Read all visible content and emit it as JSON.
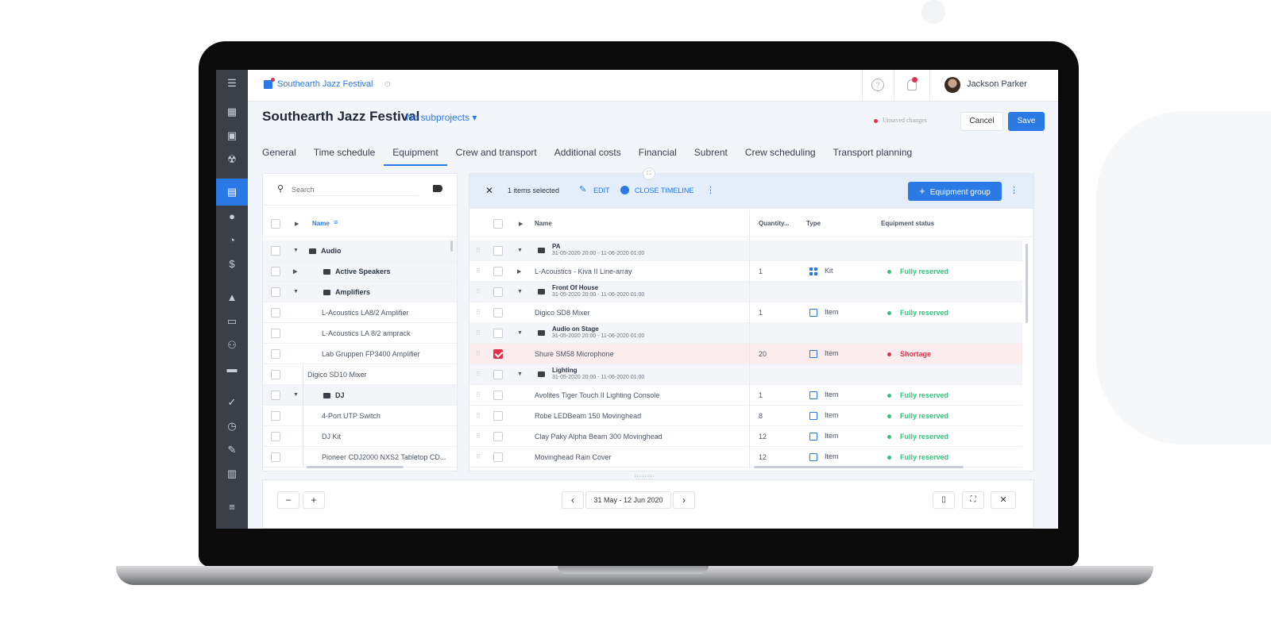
{
  "app": {
    "project_link": "Southearth Jazz Festival",
    "project_title": "Southearth Jazz Festival",
    "subprojects": "No subprojects ▾",
    "user_name": "Jackson Parker",
    "unsaved": "Unsaved changes",
    "cancel": "Cancel",
    "save": "Save"
  },
  "tabs": [
    "General",
    "Time schedule",
    "Equipment",
    "Crew and transport",
    "Additional costs",
    "Financial",
    "Subrent",
    "Crew scheduling",
    "Transport planning"
  ],
  "left_panel": {
    "search_placeholder": "Search",
    "name_header": "Name",
    "rows": [
      {
        "label": "Audio",
        "group": true,
        "indent": 0
      },
      {
        "label": "Active Speakers",
        "group": true,
        "indent": 1
      },
      {
        "label": "Amplifiers",
        "group": true,
        "indent": 1
      },
      {
        "label": "L-Acoustics LA8/2 Amplifier",
        "group": false,
        "indent": 2
      },
      {
        "label": "L-Acoustics LA 8/2 amprack",
        "group": false,
        "indent": 2
      },
      {
        "label": "Lab Gruppen FP3400 Amplifier",
        "group": false,
        "indent": 2
      },
      {
        "label": "Digico SD10 Mixer",
        "group": false,
        "indent": 1
      },
      {
        "label": "DJ",
        "group": true,
        "indent": 1
      },
      {
        "label": "4-Port UTP Switch",
        "group": false,
        "indent": 2
      },
      {
        "label": "DJ Kit",
        "group": false,
        "indent": 2
      },
      {
        "label": "Pioneer CDJ2000 NXS2 Tabletop CD...",
        "group": false,
        "indent": 2
      }
    ]
  },
  "right_panel": {
    "selected": "1 items selected",
    "edit": "EDIT",
    "close_timeline": "CLOSE TIMELINE",
    "equipment_group": "Equipment group",
    "headers": {
      "name": "Name",
      "quantity": "Quantity...",
      "type": "Type",
      "status": "Equipment status"
    },
    "rows": [
      {
        "kind": "group",
        "name": "PA",
        "date": "31-05-2020 20:00 - 11-06-2020 01:00"
      },
      {
        "kind": "item",
        "name": "L-Acoustics - Kiva II Line-array",
        "qty": "1",
        "type": "Kit",
        "status": "Fully reserved",
        "expand": true
      },
      {
        "kind": "group",
        "name": "Front Of House",
        "date": "31-05-2020 20:00 - 11-06-2020 01:00"
      },
      {
        "kind": "item",
        "name": "Digico SD8 Mixer",
        "qty": "1",
        "type": "Item",
        "status": "Fully reserved"
      },
      {
        "kind": "group",
        "name": "Audio on Stage",
        "date": "31-05-2020 20:00 - 11-06-2020 01:00"
      },
      {
        "kind": "item",
        "name": "Shure SM58 Microphone",
        "qty": "20",
        "type": "Item",
        "status": "Shortage",
        "checked": true
      },
      {
        "kind": "group",
        "name": "Lighting",
        "date": "31-05-2020 20:00 - 11-06-2020 01:00"
      },
      {
        "kind": "item",
        "name": "Avolites Tiger Touch II Lighting Console",
        "qty": "1",
        "type": "Item",
        "status": "Fully reserved"
      },
      {
        "kind": "item",
        "name": "Robe LEDBeam 150 Movinghead",
        "qty": "8",
        "type": "Item",
        "status": "Fully reserved"
      },
      {
        "kind": "item",
        "name": "Clay Paky Alpha Beam 300 Movinghead",
        "qty": "12",
        "type": "Item",
        "status": "Fully reserved"
      },
      {
        "kind": "item",
        "name": "Movinghead Rain Cover",
        "qty": "12",
        "type": "Item",
        "status": "Fully reserved"
      }
    ]
  },
  "footer": {
    "minus": "−",
    "plus": "+",
    "prev": "‹",
    "date_range": "31 May - 12 Jun 2020",
    "next": "›",
    "map_icon": "map-icon",
    "expand_icon": "expand-icon",
    "close_icon": "close-icon"
  },
  "colors": {
    "accent": "#2a79e4",
    "ok": "#34c37a",
    "shortage": "#e0314b",
    "sidebar": "#3b3f47"
  }
}
